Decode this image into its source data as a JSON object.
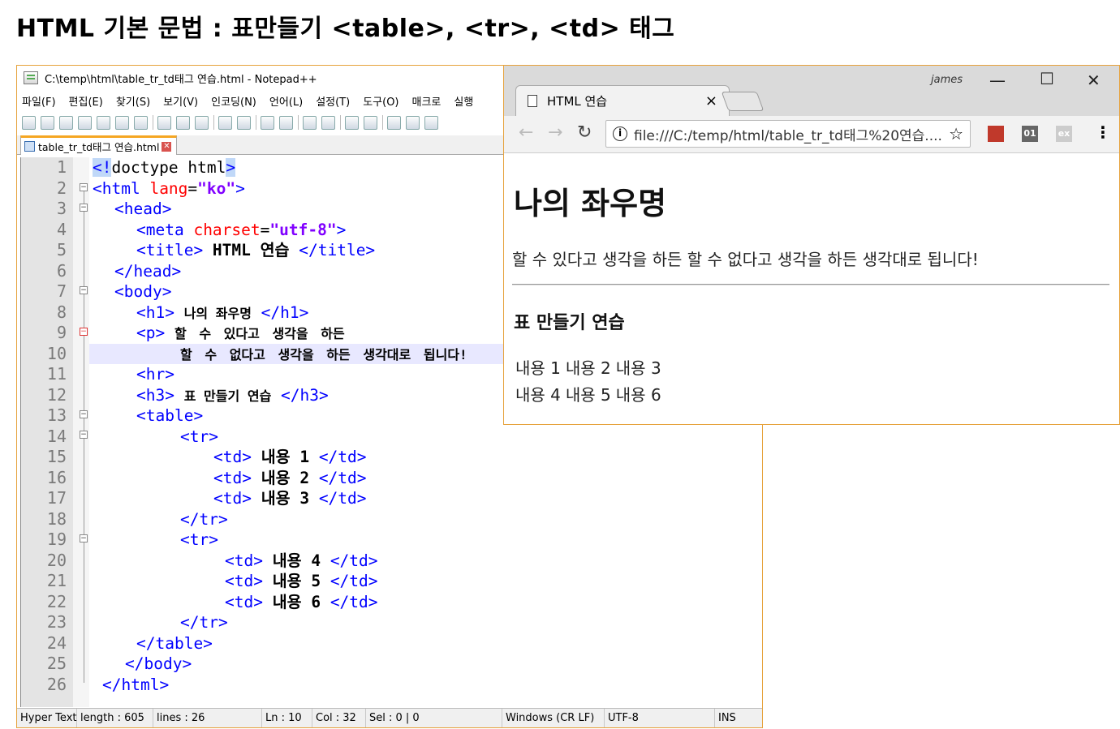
{
  "heading": "HTML 기본 문법 : 표만들기 <table>, <tr>, <td> 태그",
  "notepad": {
    "title": "C:\\temp\\html\\table_tr_td태그 연습.html - Notepad++",
    "menu": [
      "파일(F)",
      "편집(E)",
      "찾기(S)",
      "보기(V)",
      "인코딩(N)",
      "언어(L)",
      "설정(T)",
      "도구(O)",
      "매크로",
      "실행"
    ],
    "tab_label": "table_tr_td태그 연습.html",
    "line_numbers": [
      "1",
      "2",
      "3",
      "4",
      "5",
      "6",
      "7",
      "8",
      "9",
      "10",
      "11",
      "12",
      "13",
      "14",
      "15",
      "16",
      "17",
      "18",
      "19",
      "20",
      "21",
      "22",
      "23",
      "24",
      "25",
      "26"
    ],
    "code": {
      "l1_a": "<!",
      "l1_b": "doctype html",
      "l1_c": ">",
      "l2_a": "<html ",
      "l2_b": "lang",
      "l2_c": "=",
      "l2_d": "\"ko\"",
      "l2_e": ">",
      "l3": "<head>",
      "l4_a": "<meta ",
      "l4_b": "charset",
      "l4_c": "=",
      "l4_d": "\"utf-8\"",
      "l4_e": ">",
      "l5_a": "<title> ",
      "l5_b": "HTML 연습",
      "l5_c": " </title>",
      "l6": "</head>",
      "l7": "<body>",
      "l8_a": "<h1> ",
      "l8_b": "나의 좌우명",
      "l8_c": " </h1>",
      "l9_a": "<p> ",
      "l9_b": "할 수 있다고 생각을 하든",
      "l10": "할 수 없다고 생각을 하든 생각대로 됩니다!",
      "l11": "<hr>",
      "l12_a": "<h3> ",
      "l12_b": "표 만들기 연습",
      "l12_c": " </h3>",
      "l13": "<table>",
      "l14": "<tr>",
      "l15_a": "<td> ",
      "l15_b": "내용 1",
      "l15_c": " </td>",
      "l16_a": "<td> ",
      "l16_b": "내용 2",
      "l16_c": " </td>",
      "l17_a": "<td> ",
      "l17_b": "내용 3",
      "l17_c": " </td>",
      "l18": "</tr>",
      "l19": "<tr>",
      "l20_a": "<td> ",
      "l20_b": "내용 4",
      "l20_c": " </td>",
      "l21_a": "<td> ",
      "l21_b": "내용 5",
      "l21_c": " </td>",
      "l22_a": "<td> ",
      "l22_b": "내용 6",
      "l22_c": " </td>",
      "l23": "</tr>",
      "l24": "</table>",
      "l25": "</body>",
      "l26": "</html>"
    },
    "status": {
      "type": "Hyper Text",
      "length": "length : 605",
      "lines": "lines : 26",
      "ln": "Ln : 10",
      "col": "Col : 32",
      "sel": "Sel : 0 | 0",
      "eol": "Windows (CR LF)",
      "encoding": "UTF-8",
      "mode": "INS"
    }
  },
  "browser": {
    "tab_title": "HTML 연습",
    "tab_close": "×",
    "profile": "james",
    "url": "file:///C:/temp/html/table_tr_td태그%20연습....",
    "ext_pdf": "",
    "ext_01": "01",
    "ext_ex": "ex",
    "page": {
      "h1": "나의 좌우명",
      "p": "할 수 있다고 생각을 하든 할 수 없다고 생각을 하든 생각대로 됩니다!",
      "h3": "표 만들기 연습",
      "table": [
        [
          "내용 1",
          "내용 2",
          "내용 3"
        ],
        [
          "내용 4",
          "내용 5",
          "내용 6"
        ]
      ]
    }
  }
}
